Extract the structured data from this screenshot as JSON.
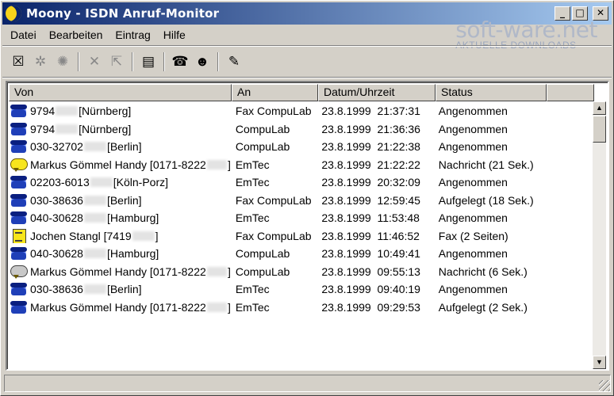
{
  "window": {
    "title": "Moony - ISDN Anruf-Monitor",
    "icon": "moon-icon",
    "controls": {
      "minimize": "_",
      "maximize": "□",
      "close": "✕"
    }
  },
  "watermark": {
    "brand": "soft-ware.net",
    "subtitle": "AKTUELLE DOWNLOADS"
  },
  "menu": [
    "Datei",
    "Bearbeiten",
    "Eintrag",
    "Hilfe"
  ],
  "toolbar": {
    "buttons": [
      {
        "name": "delete-call-icon",
        "glyph": "☒",
        "enabled": true
      },
      {
        "name": "mute-icon",
        "glyph": "✲",
        "enabled": false
      },
      {
        "name": "speaker-off-icon",
        "glyph": "✺",
        "enabled": false
      },
      {
        "name": "cut-icon",
        "glyph": "✕",
        "enabled": false
      },
      {
        "name": "export-icon",
        "glyph": "⇱",
        "enabled": false
      },
      {
        "name": "note-icon",
        "glyph": "▤",
        "enabled": true
      },
      {
        "name": "phone-icon",
        "glyph": "☎",
        "enabled": true
      },
      {
        "name": "contact-icon",
        "glyph": "☻",
        "enabled": true
      },
      {
        "name": "settings-icon",
        "glyph": "✎",
        "enabled": true
      }
    ]
  },
  "list": {
    "columns": [
      "Von",
      "An",
      "Datum/Uhrzeit",
      "Status"
    ],
    "rows": [
      {
        "icon": "phone",
        "from_a": "9794",
        "from_b": " [Nürnberg]",
        "to": "Fax CompuLab",
        "date": "23.8.1999",
        "time": "21:37:31",
        "status": "Angenommen"
      },
      {
        "icon": "phone",
        "from_a": "9794",
        "from_b": " [Nürnberg]",
        "to": "CompuLab",
        "date": "23.8.1999",
        "time": "21:36:36",
        "status": "Angenommen"
      },
      {
        "icon": "phone",
        "from_a": "030-32702",
        "from_b": " [Berlin]",
        "to": "CompuLab",
        "date": "23.8.1999",
        "time": "21:22:38",
        "status": "Angenommen"
      },
      {
        "icon": "bubble-yellow",
        "from_a": "Markus Gömmel Handy [0171-8222",
        "from_b": "]",
        "to": "EmTec",
        "date": "23.8.1999",
        "time": "21:22:22",
        "status": "Nachricht (21 Sek.)"
      },
      {
        "icon": "phone",
        "from_a": "02203-6013",
        "from_b": " [Köln-Porz]",
        "to": "EmTec",
        "date": "23.8.1999",
        "time": "20:32:09",
        "status": "Angenommen"
      },
      {
        "icon": "phone",
        "from_a": "030-38636",
        "from_b": " [Berlin]",
        "to": "Fax CompuLab",
        "date": "23.8.1999",
        "time": "12:59:45",
        "status": "Aufgelegt (18 Sek.)"
      },
      {
        "icon": "phone",
        "from_a": "040-30628",
        "from_b": " [Hamburg]",
        "to": "EmTec",
        "date": "23.8.1999",
        "time": "11:53:48",
        "status": "Angenommen"
      },
      {
        "icon": "fax",
        "from_a": "Jochen Stangl [7419",
        "from_b": "]",
        "to": "Fax CompuLab",
        "date": "23.8.1999",
        "time": "11:46:52",
        "status": "Fax (2 Seiten)"
      },
      {
        "icon": "phone",
        "from_a": "040-30628",
        "from_b": " [Hamburg]",
        "to": "CompuLab",
        "date": "23.8.1999",
        "time": "10:49:41",
        "status": "Angenommen"
      },
      {
        "icon": "bubble-grey",
        "from_a": "Markus Gömmel Handy [0171-8222",
        "from_b": "]",
        "to": "CompuLab",
        "date": "23.8.1999",
        "time": "09:55:13",
        "status": "Nachricht (6 Sek.)"
      },
      {
        "icon": "phone",
        "from_a": "030-38636",
        "from_b": " [Berlin]",
        "to": "EmTec",
        "date": "23.8.1999",
        "time": "09:40:19",
        "status": "Angenommen"
      },
      {
        "icon": "phone",
        "from_a": "Markus Gömmel Handy [0171-8222",
        "from_b": "]",
        "to": "EmTec",
        "date": "23.8.1999",
        "time": "09:29:53",
        "status": "Aufgelegt (2 Sek.)"
      }
    ]
  },
  "scrollbar": {
    "up": "▲",
    "down": "▼"
  }
}
